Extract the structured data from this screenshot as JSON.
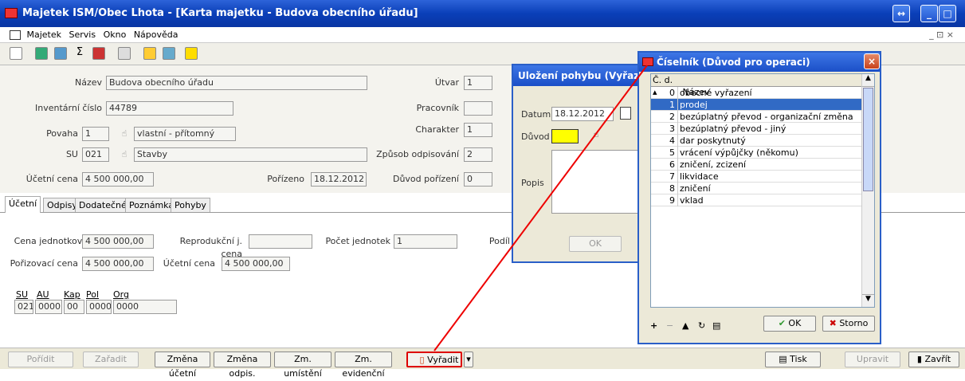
{
  "window": {
    "title": "Majetek ISM/Obec Lhota - [Karta majetku - Budova obecního úřadu]"
  },
  "menu": [
    "Majetek",
    "Servis",
    "Okno",
    "Nápověda"
  ],
  "form": {
    "nazev_label": "Název",
    "nazev_value": "Budova obecního úřadu",
    "inv_label": "Inventární číslo",
    "inv_value": "44789",
    "povaha_label": "Povaha",
    "povaha_code": "1",
    "povaha_text": "vlastní - přítomný",
    "su_label": "SU",
    "su_code": "021",
    "su_text": "Stavby",
    "ucetni_label": "Účetní cena",
    "ucetni_value": "4 500 000,00",
    "porizeno_label": "Pořízeno",
    "porizeno_value": "18.12.2012",
    "utvar_label": "Útvar",
    "utvar_value": "1",
    "pracovnik_label": "Pracovník",
    "pracovnik_value": "",
    "charakter_label": "Charakter",
    "charakter_value": "1",
    "odpis_label": "Způsob odpisování",
    "odpis_value": "2",
    "duvod_label": "Důvod pořízení",
    "duvod_value": "0"
  },
  "tabs": [
    "Účetní",
    "Odpisy",
    "Dodatečné",
    "Poznámka",
    "Pohyby"
  ],
  "detail": {
    "cena_jed_label": "Cena jednotková",
    "cena_jed_value": "4 500 000,00",
    "repro_label": "Reprodukční j. cena",
    "repro_value": "",
    "pocet_label": "Počet jednotek",
    "pocet_value": "1",
    "podil_label": "Podíl",
    "poriz_label": "Pořizovací cena",
    "poriz_value": "4 500 000,00",
    "ucetni2_label": "Účetní cena",
    "ucetni2_value": "4 500 000,00",
    "cols": [
      "SU",
      "AU",
      "Kap",
      "Pol",
      "Org"
    ],
    "vals": [
      "021",
      "0000",
      "00",
      "0000",
      "0000"
    ]
  },
  "bottom": {
    "poridit": "Pořídit",
    "zaradit": "Zařadit",
    "zmena_ucetni": "Změna účetní",
    "zmena_odpis": "Změna odpis.",
    "zm_umisteni": "Zm. umístění",
    "zm_evidencni": "Zm. evidenční",
    "vyradit": "Vyřadit",
    "tisk": "Tisk",
    "upravit": "Upravit",
    "zavrit": "Zavřít"
  },
  "dialog1": {
    "title": "Uložení pohybu (Vyřazen",
    "datum_label": "Datum",
    "datum_value": "18.12.2012",
    "duvod_label": "Důvod",
    "duvod_value": "",
    "popis_label": "Popis",
    "ok": "OK"
  },
  "dialog2": {
    "title": "Číselník (Důvod pro operaci)",
    "col_code": "Č. d.",
    "col_name": "Název",
    "rows": [
      {
        "code": "0",
        "name": "obecné vyřazení"
      },
      {
        "code": "1",
        "name": "prodej"
      },
      {
        "code": "2",
        "name": "bezúplatný převod - organizační změna"
      },
      {
        "code": "3",
        "name": "bezúplatný převod - jiný"
      },
      {
        "code": "4",
        "name": "dar poskytnutý"
      },
      {
        "code": "5",
        "name": "vrácení výpůjčky (někomu)"
      },
      {
        "code": "6",
        "name": "zničení, zcizení"
      },
      {
        "code": "7",
        "name": "likvidace"
      },
      {
        "code": "8",
        "name": "zničení"
      },
      {
        "code": "9",
        "name": "vklad"
      }
    ],
    "ok": "OK",
    "storno": "Storno"
  }
}
